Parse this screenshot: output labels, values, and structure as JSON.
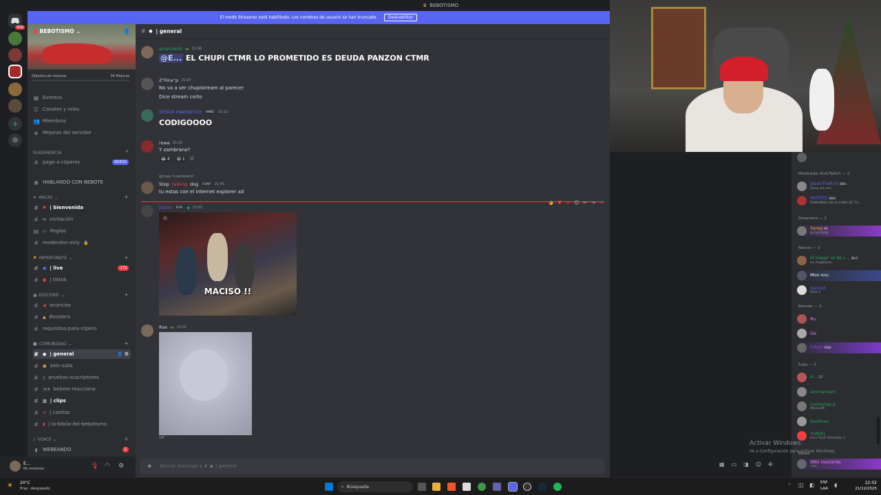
{
  "window": {
    "title": "BEBOTISMO"
  },
  "streamer_bar": {
    "text": "El modo Streamer está habilitado. Los nombres de usuario se han truncado.",
    "button": "Deshabilitar"
  },
  "guilds": {
    "dm_count": "410"
  },
  "server": {
    "name": "BEBOTISMO",
    "boost_goal": "Objetivo de mejoras",
    "boost_count": "34 Mejoras",
    "items": [
      "Eventos",
      "Canales y roles",
      "Miembros",
      "Mejoras del servidor"
    ],
    "suggestion_label": "Sugerencia",
    "suggested_channel": "pago-a-cliperos",
    "new_badge": "NUEVO",
    "hablando": "HABLANDO CON BEBOTE",
    "categories": {
      "inicio": "INICIO",
      "importante": "IMPORTANTE",
      "discord": "DISCORD",
      "comunidad": "COMUNIDAD",
      "voice": "VOICE"
    },
    "channels": {
      "bienvenida": "| bienvenida",
      "invitacion": "Invitación",
      "reglas": "Reglas",
      "moderator": "moderator-only",
      "live": "| live",
      "live_badge": "179",
      "tiktok": "| tiktok",
      "anuncios": "anuncios",
      "boosters": "Boosters",
      "requisitos": "requisitos-para-clipero",
      "general": "| general",
      "solosubs": "solo-subs",
      "pruebas": "pruebas-suscriptores",
      "bebote": "bebote-reacciona",
      "clips": "| clips",
      "caletas": "| caletas",
      "biblia": "| la-biblia-del-bebotismo",
      "webeando": "WEBEANDO",
      "webeando_badge": "1"
    }
  },
  "user": {
    "name": "E...",
    "status": "No molestar"
  },
  "chat": {
    "channel": "| general",
    "messages": [
      {
        "author": "alvarrokkk",
        "time": "21:06",
        "mention": "@E...",
        "text": "EL CHUPI CTMR LO PROMETIDO ES DEUDA PANZON CTMR"
      },
      {
        "author": "Z°Finx°p",
        "time": "21:07",
        "line1": "No va a ser chupistream al parecer",
        "line2": "Dice stream corto"
      },
      {
        "author": "SEÑOR MAGNIFICO",
        "tag": "AKNS",
        "time": "21:12",
        "text": "CODIGOOOO"
      },
      {
        "author": "rowe",
        "time": "21:22",
        "text": "Y zambrano?",
        "r1": "4",
        "r2": "1"
      },
      {
        "reply_user": "@rowe",
        "reply_text": "Y zambrano?",
        "author": "Stop",
        "author2": "talking",
        "author3": "dog",
        "tag": "FUAP",
        "time": "21:41",
        "text": "tu estas con el internet explorer xd"
      },
      {
        "author": "Edom",
        "tag": "EGO",
        "time": "22:01",
        "gif_caption": "MACISO !!"
      },
      {
        "author": "Rax",
        "time": "22:01",
        "gif_label": "GIF"
      }
    ],
    "input_placeholder": "Enviar mensaje a #",
    "input_channel": "| general"
  },
  "members": {
    "groups": [
      {
        "label": "Moderador Kick/Twitch — 2",
        "items": [
          {
            "name": "JasonTheFch",
            "tag": "BBG",
            "sub": "Estoy ma ven"
          },
          {
            "name": "MOTITO",
            "tag": "BBG",
            "sub": "PENSANDO EN LA CAMA DE TU ..."
          }
        ]
      },
      {
        "label": "Streamers — 1",
        "items": [
          {
            "name": "Yuraq",
            "tag": "FA",
            "sub": "KLOUFRENS"
          }
        ]
      },
      {
        "label": "Narcos — 3",
        "items": [
          {
            "name": "El mago' el de L...",
            "tag": "BLG",
            "sub": "los magicosss"
          },
          {
            "name": "Mos",
            "tag": "PERU",
            "sub": ""
          },
          {
            "name": "Sacred",
            "tag": "",
            "sub": "Dota 2"
          }
        ]
      },
      {
        "label": "Booster — 3",
        "items": [
          {
            "name": "Ru",
            "tag": "",
            "sub": ""
          },
          {
            "name": "Ge",
            "tag": "",
            "sub": ""
          },
          {
            "name": "Edom",
            "tag": "EGO",
            "sub": ""
          }
        ]
      },
      {
        "label": "Subs — 5",
        "items": [
          {
            "name": "A...",
            "tag": "27",
            "sub": ""
          },
          {
            "name": "ammamam",
            "tag": "",
            "sub": ""
          },
          {
            "name": "Carlostap.p",
            "tag": "",
            "sub": "Minecraft"
          },
          {
            "name": "Dedmon",
            "tag": "",
            "sub": ""
          },
          {
            "name": "YURIEL",
            "tag": "",
            "sub": "Euro Truck Simulator 2"
          }
        ]
      },
      {
        "label": "Bebes",
        "items": [
          {
            "name": "BBG bastarda",
            "tag": "",
            "sub": "caro"
          }
        ]
      }
    ]
  },
  "watermark": {
    "line1": "Activar Windows",
    "line2": "Ve a Configuración para activar Windows."
  },
  "taskbar": {
    "weather_temp": "20°C",
    "weather_desc": "Prac. despejado",
    "search": "Búsqueda",
    "lang1": "ESP",
    "lang2": "LAA",
    "time": "22:02",
    "date": "21/12/2025"
  },
  "colors": {
    "accent": "#5865f2",
    "mention": "#f23f42",
    "bg": "#313338"
  }
}
